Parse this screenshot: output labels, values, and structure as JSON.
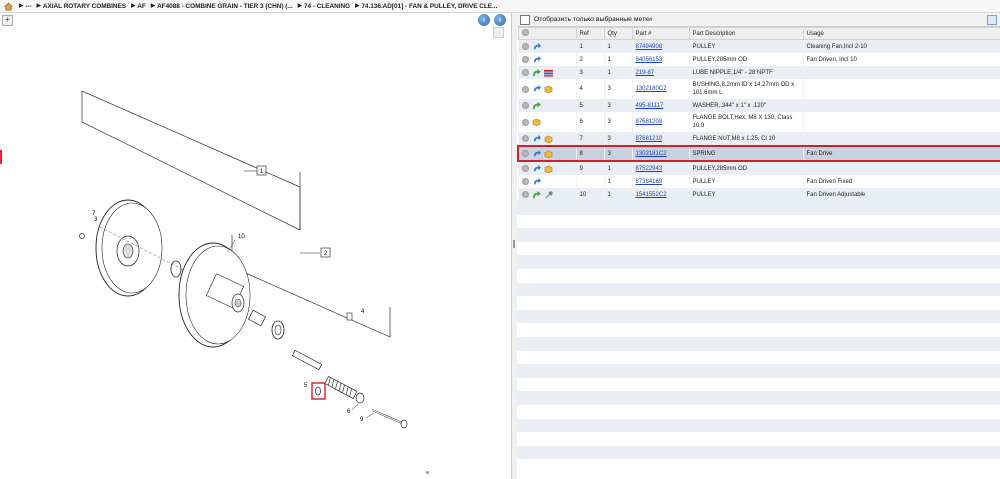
{
  "breadcrumb": {
    "items": [
      "---",
      "AXIAL ROTARY COMBINES",
      "AF",
      "AF4088 - COMBINE GRAIN - TIER 3 (CHN) (...",
      "74 - CLEANING",
      "74.136.AD[01] - FAN & PULLEY, DRIVE CLE..."
    ]
  },
  "filter": {
    "label": "Отобразить только выбранные метки",
    "checked": false
  },
  "table": {
    "headers": [
      "Ref",
      "Qty",
      "Part #",
      "Part Description",
      "Usage"
    ],
    "rows": [
      {
        "ref": "1",
        "qty": "1",
        "part": "87494908",
        "desc": "PULLEY",
        "usage": "Cleaning Fan,Incl 2-10",
        "icons": [
          "circle",
          "blue-arrow"
        ]
      },
      {
        "ref": "2",
        "qty": "1",
        "part": "84056153",
        "desc": "PULLEY,285mm OD",
        "usage": "Fan Driven, Incl 10",
        "icons": [
          "circle",
          "blue-arrow"
        ]
      },
      {
        "ref": "3",
        "qty": "1",
        "part": "219-87",
        "desc": "LUBE NIPPLE,1/4\" - 28 NPTF",
        "usage": "",
        "icons": [
          "circle",
          "green-arrow",
          "red-stripes"
        ]
      },
      {
        "ref": "4",
        "qty": "3",
        "part": "1302180C2",
        "desc": "BUSHING,8.2mm ID x 14.27mm OD x 101.6mm L",
        "usage": "",
        "icons": [
          "circle",
          "blue-arrow",
          "box"
        ]
      },
      {
        "ref": "5",
        "qty": "3",
        "part": "495-81117",
        "desc": "WASHER,.344\" x 1\" x .120\"",
        "usage": "",
        "icons": [
          "circle",
          "green-arrow"
        ]
      },
      {
        "ref": "6",
        "qty": "3",
        "part": "87681208",
        "desc": "FLANGE BOLT,Hex, M8 X 130, Class 10.9",
        "usage": "",
        "icons": [
          "circle",
          "box"
        ]
      },
      {
        "ref": "7",
        "qty": "3",
        "part": "87681210",
        "desc": "FLANGE NUT,M8 x 1.25, Cl 10",
        "usage": "",
        "icons": [
          "circle",
          "blue-arrow",
          "box"
        ]
      },
      {
        "ref": "8",
        "qty": "3",
        "part": "1302181C2",
        "desc": "SPRING",
        "usage": "Fan Drive",
        "icons": [
          "circle",
          "blue-arrow",
          "box"
        ],
        "selected": true
      },
      {
        "ref": "9",
        "qty": "1",
        "part": "87522943",
        "desc": "PULLEY,285mm OD",
        "usage": "",
        "icons": [
          "circle",
          "blue-arrow",
          "box"
        ]
      },
      {
        "ref": "",
        "qty": "1",
        "part": "87384189",
        "desc": "PULLEY",
        "usage": "Fan Driven Fixed",
        "icons": [
          "circle",
          "blue-arrow"
        ]
      },
      {
        "ref": "10",
        "qty": "1",
        "part": "1541552C2",
        "desc": "PULLEY",
        "usage": "Fan Driven Adjustable",
        "icons": [
          "circle",
          "green-arrow",
          "wrench"
        ]
      }
    ]
  },
  "diagram": {
    "callouts": [
      "1",
      "2",
      "3",
      "4",
      "5",
      "6",
      "7",
      "9",
      "10"
    ]
  },
  "colors": {
    "selection_border": "#d0202a",
    "link": "#1a3fd1",
    "row_alt": "#e9eef5"
  }
}
